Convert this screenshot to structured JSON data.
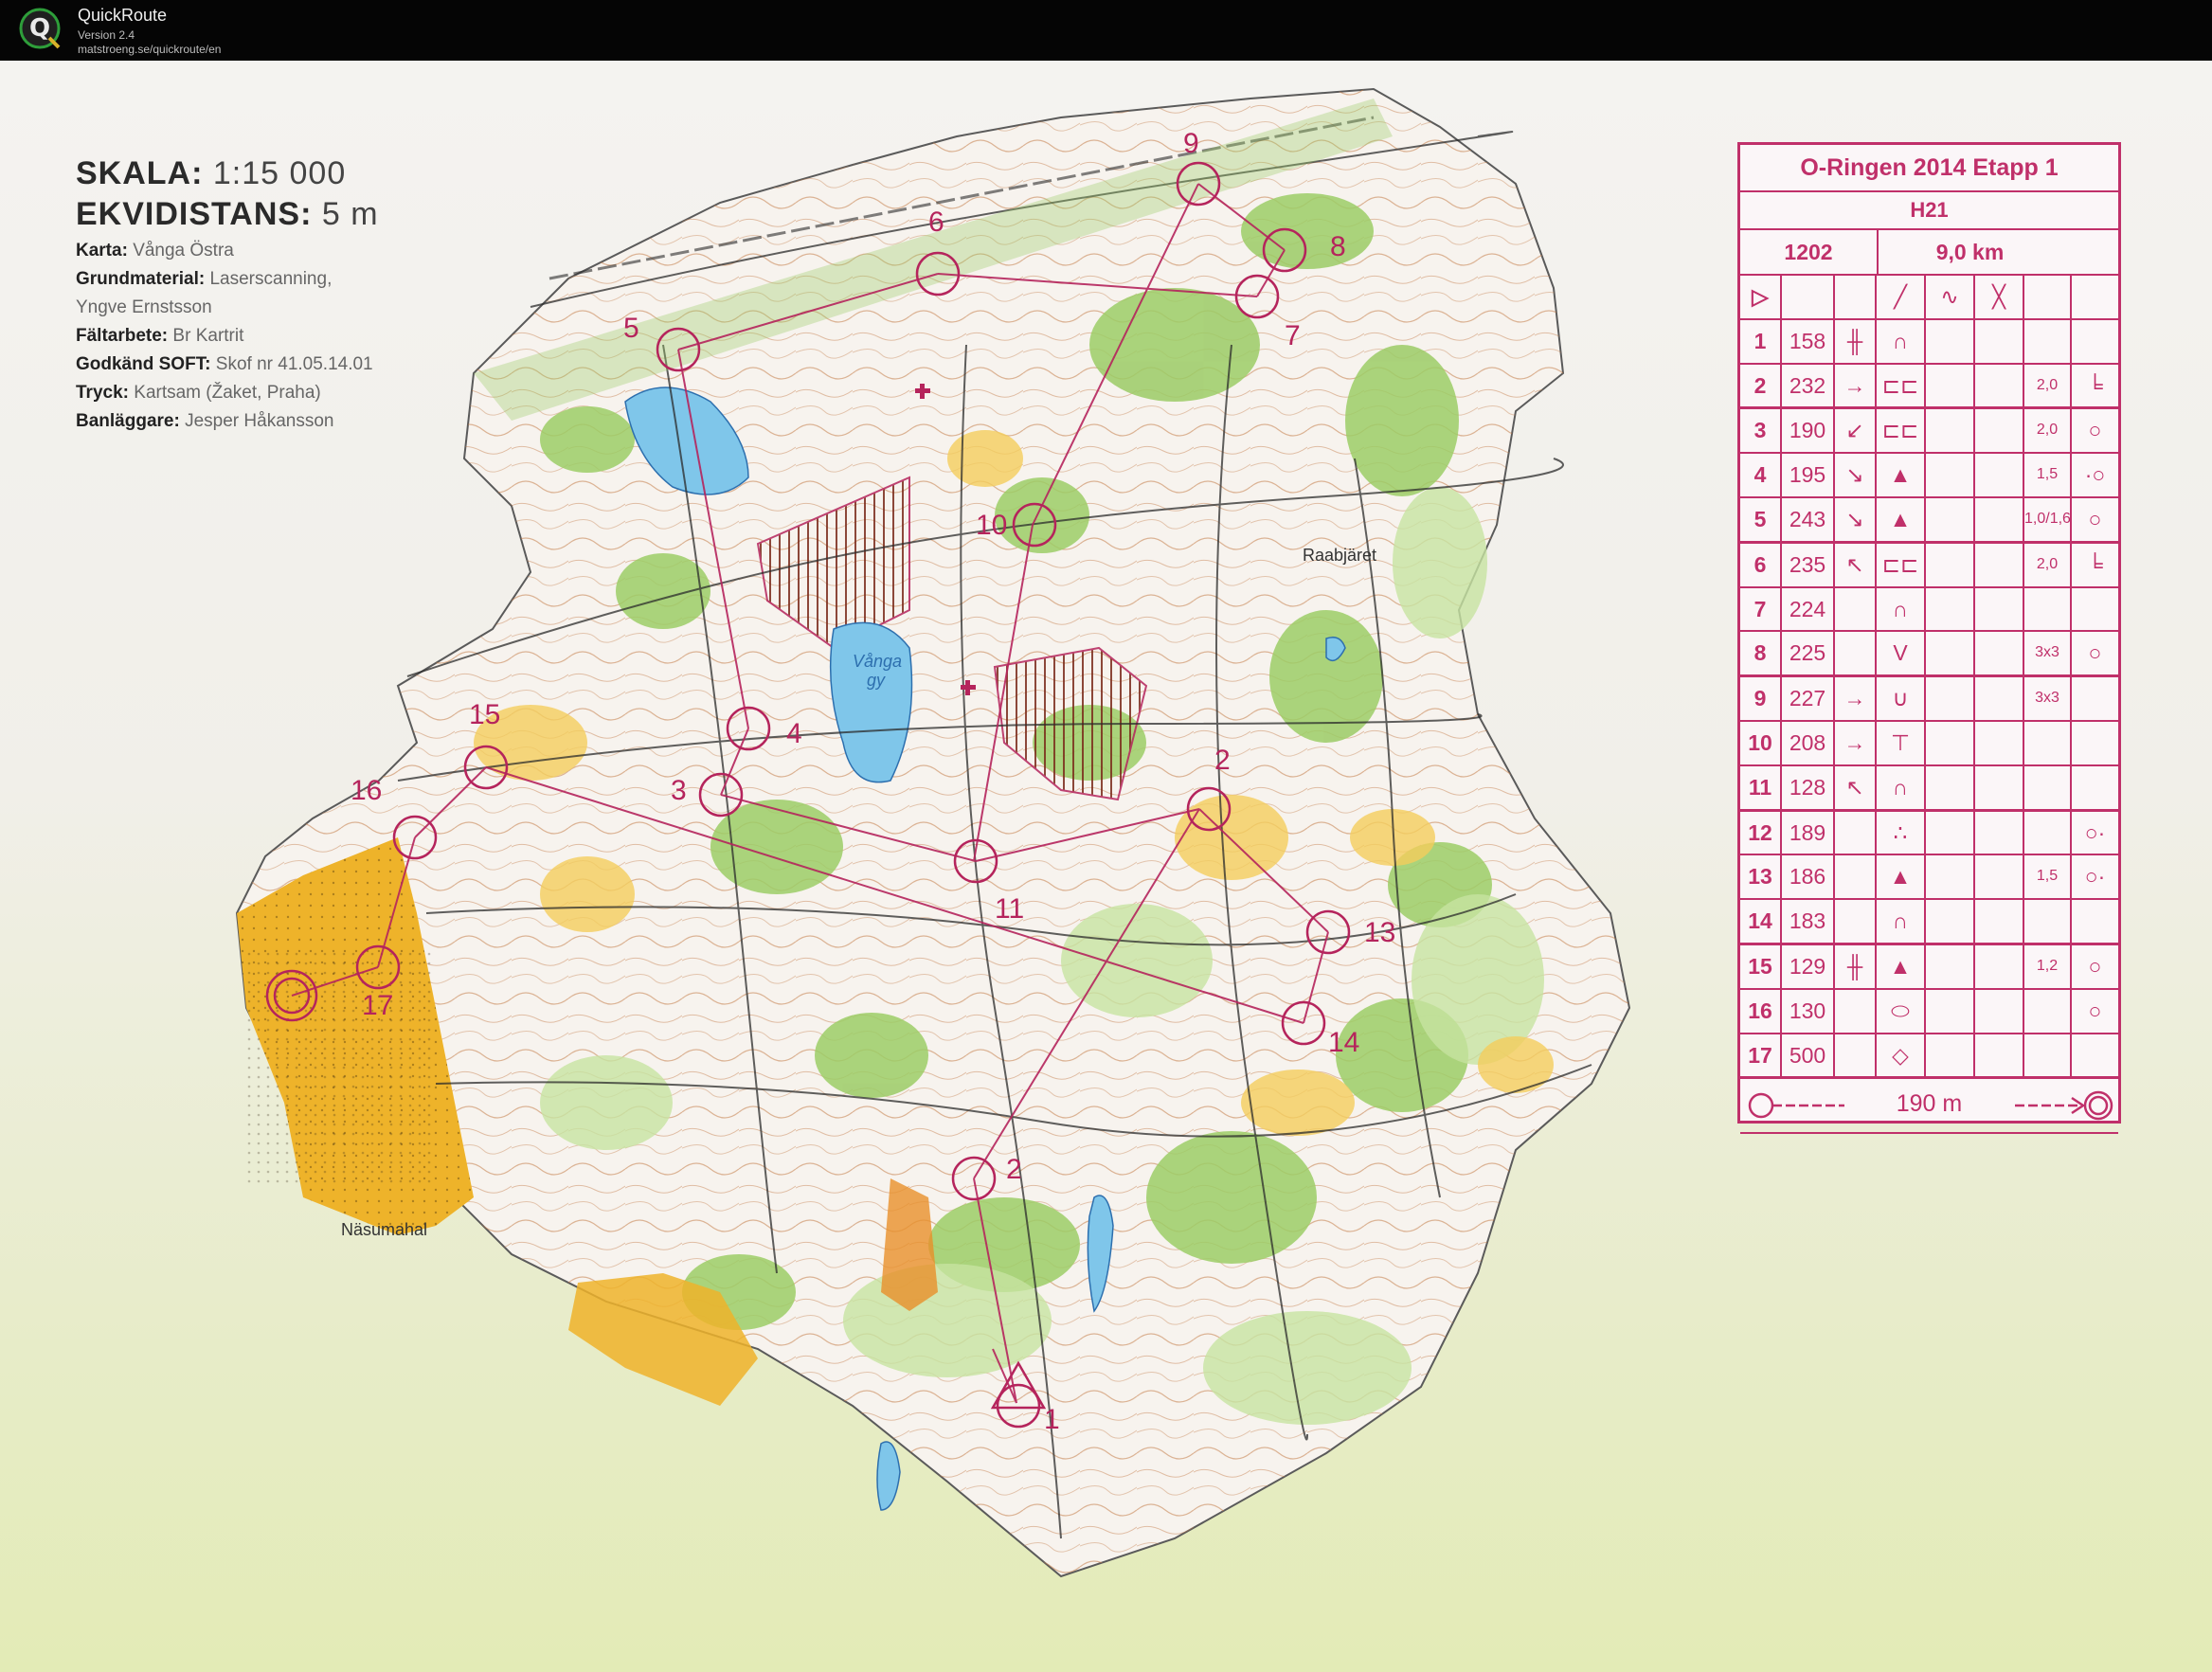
{
  "app": {
    "name": "QuickRoute",
    "version": "Version 2.4",
    "url": "matstroeng.se/quickroute/en",
    "logo_letter": "Q",
    "logo_color": "#2e9e3a"
  },
  "legend": {
    "scale_label": "SKALA:",
    "scale_value": "1:15 000",
    "contour_label": "EKVIDISTANS:",
    "contour_value": "5 m",
    "rows": [
      {
        "label": "Karta:",
        "value": "Vånga Östra"
      },
      {
        "label": "Grundmaterial:",
        "value": "Laserscanning,"
      },
      {
        "label": "",
        "value": "Yngve Ernstsson"
      },
      {
        "label": "Fältarbete:",
        "value": "Br Kartrit"
      },
      {
        "label": "Godkänd SOFT:",
        "value": "Skof nr 41.05.14.01"
      },
      {
        "label": "Tryck:",
        "value": "Kartsam (Žaket, Praha)"
      },
      {
        "label": "Banläggare:",
        "value": "Jesper Håkansson"
      }
    ]
  },
  "map": {
    "place_names": [
      "Vånga gy",
      "Raabjäret",
      "Näsumahal"
    ],
    "controls": [
      {
        "no": "1"
      },
      {
        "no": "2"
      },
      {
        "no": "3"
      },
      {
        "no": "4"
      },
      {
        "no": "5"
      },
      {
        "no": "6"
      },
      {
        "no": "7"
      },
      {
        "no": "8"
      },
      {
        "no": "9"
      },
      {
        "no": "10"
      },
      {
        "no": "11"
      },
      {
        "no": "12"
      },
      {
        "no": "13"
      },
      {
        "no": "14"
      },
      {
        "no": "15"
      },
      {
        "no": "16"
      },
      {
        "no": "17"
      }
    ],
    "course_color": "#b5245c",
    "colors": {
      "forest": "#f5f3ee",
      "green": "#8fc45a",
      "light_green": "#c6e3a0",
      "open": "#f3c645",
      "field": "#eeb32a",
      "water": "#7fc6ea",
      "contour": "#b86a3a"
    }
  },
  "control_sheet": {
    "title": "O-Ringen 2014 Etapp 1",
    "class": "H21",
    "course": "1202",
    "length": "9,0 km",
    "start_symbol": "▷",
    "header_symbols": [
      "╱",
      "∿",
      "╳"
    ],
    "rows": [
      {
        "no": "1",
        "code": "158",
        "c": "╫",
        "d": "∩",
        "e": "",
        "f": "",
        "g": "",
        "h": ""
      },
      {
        "no": "2",
        "code": "232",
        "c": "→",
        "d": "⊏⊏",
        "e": "",
        "f": "",
        "g": "2,0",
        "h": "╘"
      },
      {
        "no": "3",
        "code": "190",
        "c": "↙",
        "d": "⊏⊏",
        "e": "",
        "f": "",
        "g": "2,0",
        "h": "○"
      },
      {
        "no": "4",
        "code": "195",
        "c": "↘",
        "d": "▲",
        "e": "",
        "f": "",
        "g": "1,5",
        "h": "·○"
      },
      {
        "no": "5",
        "code": "243",
        "c": "↘",
        "d": "▲",
        "e": "",
        "f": "",
        "g": "1,0/1,6",
        "h": "○"
      },
      {
        "no": "6",
        "code": "235",
        "c": "↖",
        "d": "⊏⊏",
        "e": "",
        "f": "",
        "g": "2,0",
        "h": "╘"
      },
      {
        "no": "7",
        "code": "224",
        "c": "",
        "d": "∩",
        "e": "",
        "f": "",
        "g": "",
        "h": ""
      },
      {
        "no": "8",
        "code": "225",
        "c": "",
        "d": "V",
        "e": "",
        "f": "",
        "g": "3x3",
        "h": "○"
      },
      {
        "no": "9",
        "code": "227",
        "c": "→",
        "d": "∪",
        "e": "",
        "f": "",
        "g": "3x3",
        "h": ""
      },
      {
        "no": "10",
        "code": "208",
        "c": "→",
        "d": "⊤",
        "e": "",
        "f": "",
        "g": "",
        "h": ""
      },
      {
        "no": "11",
        "code": "128",
        "c": "↖",
        "d": "∩",
        "e": "",
        "f": "",
        "g": "",
        "h": ""
      },
      {
        "no": "12",
        "code": "189",
        "c": "",
        "d": "∴",
        "e": "",
        "f": "",
        "g": "",
        "h": "○·"
      },
      {
        "no": "13",
        "code": "186",
        "c": "",
        "d": "▲",
        "e": "",
        "f": "",
        "g": "1,5",
        "h": "○·"
      },
      {
        "no": "14",
        "code": "183",
        "c": "",
        "d": "∩",
        "e": "",
        "f": "",
        "g": "",
        "h": ""
      },
      {
        "no": "15",
        "code": "129",
        "c": "╫",
        "d": "▲",
        "e": "",
        "f": "",
        "g": "1,2",
        "h": "○"
      },
      {
        "no": "16",
        "code": "130",
        "c": "",
        "d": "⬭",
        "e": "",
        "f": "",
        "g": "",
        "h": "○"
      },
      {
        "no": "17",
        "code": "500",
        "c": "",
        "d": "◇",
        "e": "",
        "f": "",
        "g": "",
        "h": ""
      }
    ],
    "finish_distance": "190 m"
  }
}
